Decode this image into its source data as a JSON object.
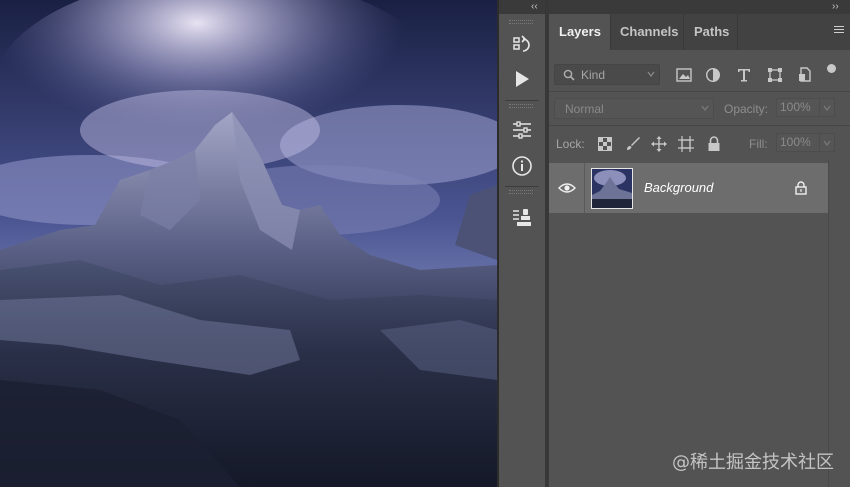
{
  "canvas": {
    "colors": {
      "sky_top": "#1c2245",
      "sky_mid": "#4a5490",
      "cloud_glow": "#e8e0f6",
      "mountain": "#6d7496",
      "mountain_dark": "#2a2f4a",
      "ground": "#1a1f30"
    }
  },
  "dock": {
    "collapse_left": "‹‹",
    "buttons": [
      {
        "icon": "history-icon"
      },
      {
        "icon": "play-actions-icon"
      },
      {
        "icon": "adjustments-icon"
      },
      {
        "icon": "info-icon"
      },
      {
        "icon": "clone-source-icon"
      }
    ]
  },
  "panel": {
    "collapse_right": "››",
    "tabs": [
      {
        "label": "Layers",
        "active": true
      },
      {
        "label": "Channels",
        "active": false
      },
      {
        "label": "Paths",
        "active": false
      }
    ],
    "filter": {
      "kind_label": "Kind",
      "icons": [
        "image-filter-icon",
        "adjustment-filter-icon",
        "type-filter-icon",
        "shape-filter-icon",
        "smart-object-filter-icon"
      ]
    },
    "blend": {
      "mode": "Normal",
      "opacity_label": "Opacity:",
      "opacity_value": "100%"
    },
    "lock": {
      "label": "Lock:",
      "icons": [
        "lock-transparent-pixels-icon",
        "lock-image-pixels-icon",
        "lock-position-icon",
        "lock-artboard-icon",
        "lock-all-icon"
      ],
      "fill_label": "Fill:",
      "fill_value": "100%"
    },
    "layers": [
      {
        "name": "Background",
        "visible": true,
        "locked": true
      }
    ]
  },
  "watermark": "@稀土掘金技术社区",
  "colors": {
    "panel_bg": "#535353",
    "tab_bar_bg": "#424242",
    "selected_layer_bg": "#6d6d6d"
  }
}
